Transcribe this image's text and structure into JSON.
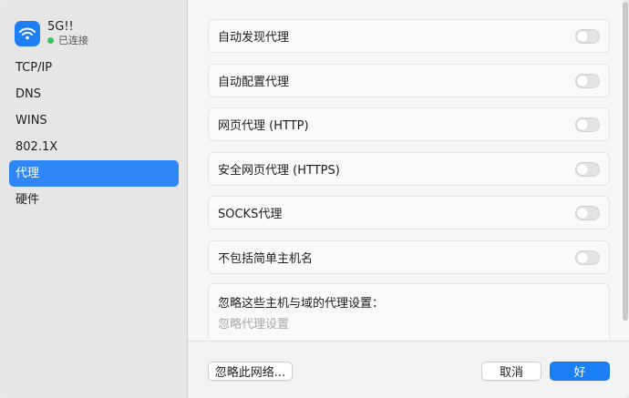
{
  "network": {
    "name": "5G!!",
    "status": "已连接",
    "icon": "wifi-icon",
    "status_color": "#34c759"
  },
  "sidebar": {
    "items": [
      {
        "label": "TCP/IP",
        "selected": false
      },
      {
        "label": "DNS",
        "selected": false
      },
      {
        "label": "WINS",
        "selected": false
      },
      {
        "label": "802.1X",
        "selected": false
      },
      {
        "label": "代理",
        "selected": true
      },
      {
        "label": "硬件",
        "selected": false
      }
    ]
  },
  "proxies": [
    {
      "label": "自动发现代理",
      "enabled": false
    },
    {
      "label": "自动配置代理",
      "enabled": false
    },
    {
      "label": "网页代理 (HTTP)",
      "enabled": false
    },
    {
      "label": "安全网页代理 (HTTPS)",
      "enabled": false
    },
    {
      "label": "SOCKS代理",
      "enabled": false
    },
    {
      "label": "不包括简单主机名",
      "enabled": false
    }
  ],
  "bypass": {
    "label": "忽略这些主机与域的代理设置：",
    "value": "",
    "placeholder": "忽略代理设置"
  },
  "footer": {
    "forget_label": "忽略此网络...",
    "cancel_label": "取消",
    "ok_label": "好"
  },
  "colors": {
    "accent": "#1a7ff5",
    "selection": "#2f86f6"
  }
}
